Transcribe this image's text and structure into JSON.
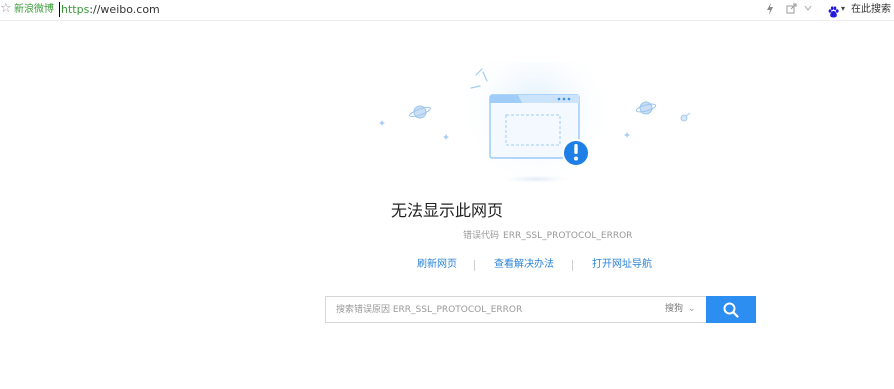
{
  "toolbar": {
    "site_name": "新浪微博",
    "url_scheme": "https",
    "url_rest": "://weibo.com",
    "search_here_label": "在此搜索"
  },
  "error": {
    "title": "无法显示此网页",
    "code_label": "错误代码",
    "code_value": "ERR_SSL_PROTOCOL_ERROR"
  },
  "links": {
    "refresh": "刷新网页",
    "solutions": "查看解决办法",
    "nav": "打开网址导航"
  },
  "search": {
    "placeholder": "搜索错误原因 ERR_SSL_PROTOCOL_ERROR",
    "engine": "搜狗"
  },
  "colors": {
    "accent": "#2d8ef2",
    "link": "#2b84d6",
    "site_green": "#3b9a3b"
  },
  "icons": [
    "star-icon",
    "bolt-icon",
    "share-icon",
    "baidu-icon",
    "search-icon",
    "exclamation-icon",
    "planet-icon",
    "sparkle-icon"
  ]
}
